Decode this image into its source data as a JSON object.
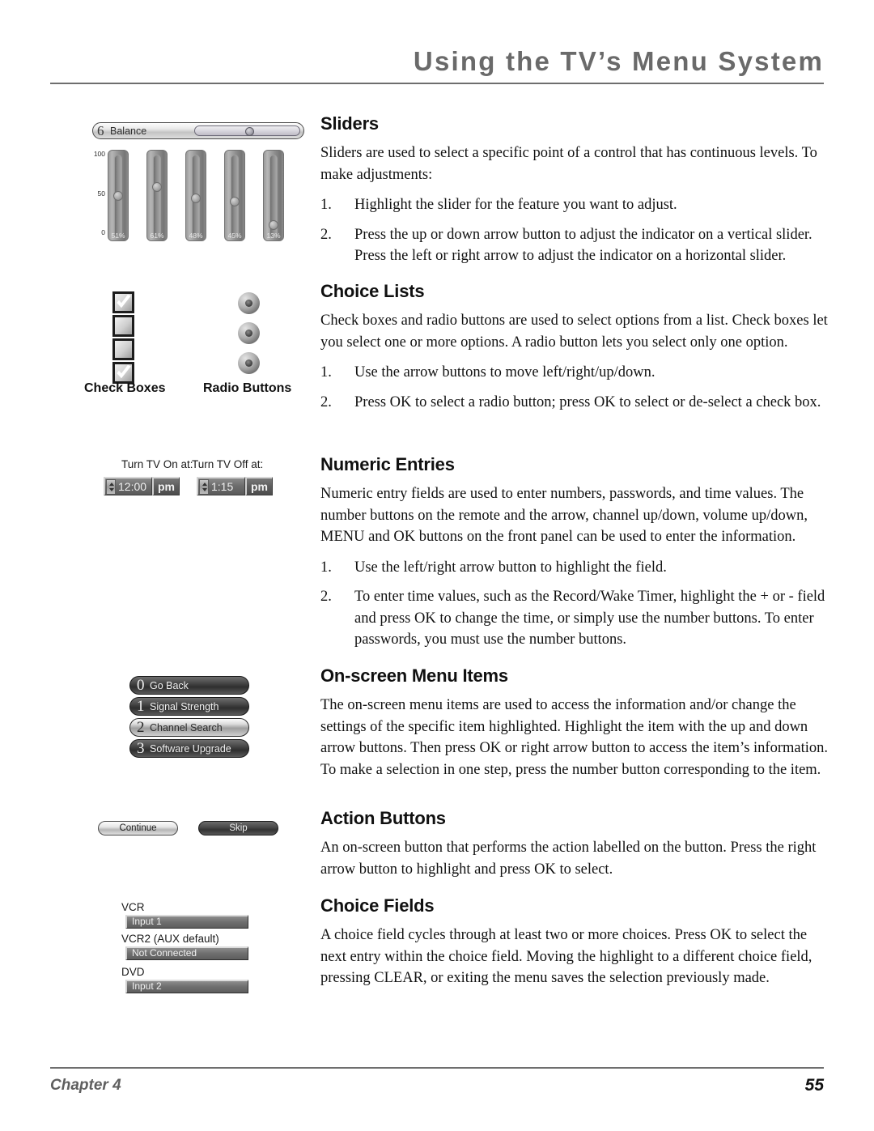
{
  "header": {
    "title": "Using the TV’s Menu System"
  },
  "footer": {
    "chapter": "Chapter 4",
    "page_number": "55"
  },
  "sections": {
    "sliders": {
      "heading": "Sliders",
      "intro": "Sliders are used to select a specific point of a control that has continuous levels. To make adjustments:",
      "steps": [
        {
          "num": "1.",
          "text": "Highlight the slider for the feature you want to adjust."
        },
        {
          "num": "2.",
          "text": "Press the up or down arrow button to adjust the indicator on a vertical slider. Press the left or right arrow to adjust the indicator on a horizontal slider."
        }
      ]
    },
    "choice_lists": {
      "heading": "Choice Lists",
      "intro": "Check boxes and radio buttons are used to select options from a list. Check boxes let you select one or more options. A radio button lets you select only one option.",
      "steps": [
        {
          "num": "1.",
          "text": "Use the arrow buttons to move left/right/up/down."
        },
        {
          "num": "2.",
          "text": "Press OK to select a radio button; press OK to select or de-select a check box."
        }
      ]
    },
    "numeric_entries": {
      "heading": "Numeric Entries",
      "intro": "Numeric entry fields are used to enter numbers, passwords, and time values. The number buttons on the remote and the arrow, channel up/down, volume up/down,  MENU and OK buttons on the front panel can be used to enter the information.",
      "steps": [
        {
          "num": "1.",
          "text": "Use the left/right arrow button to highlight the field."
        },
        {
          "num": "2.",
          "text": "To enter time values, such as the Record/Wake Timer, highlight the + or - field and press OK to change the time, or simply use the number buttons. To enter passwords, you must use the number buttons."
        }
      ]
    },
    "on_screen_menu_items": {
      "heading": "On-screen Menu Items",
      "intro": "The on-screen menu items are used to access the information and/or change the settings of the specific item highlighted. Highlight the item with the up and down arrow buttons. Then press OK or right arrow button to access the item’s information. To make a selection in one step, press the number button corresponding to the item."
    },
    "action_buttons": {
      "heading": "Action Buttons",
      "intro": "An on-screen button that performs the action labelled on the button. Press the right arrow button to highlight and press OK to select."
    },
    "choice_fields": {
      "heading": "Choice Fields",
      "intro": "A choice field cycles through at least two or more choices. Press OK to select the next entry within the choice field. Moving the highlight to a different choice field, pressing CLEAR, or exiting the menu saves the selection previously made."
    }
  },
  "figures": {
    "slider_figure": {
      "balance": {
        "number": "6",
        "label": "Balance"
      },
      "axis_ticks": [
        "100",
        "50",
        "0"
      ],
      "vertical_sliders": [
        {
          "percent": "51%",
          "value": 51
        },
        {
          "percent": "61%",
          "value": 61
        },
        {
          "percent": "48%",
          "value": 48
        },
        {
          "percent": "45%",
          "value": 45
        },
        {
          "percent": "13%",
          "value": 13
        }
      ]
    },
    "choice_list_figure": {
      "check_boxes_caption": "Check Boxes",
      "radio_buttons_caption": "Radio Buttons",
      "check_boxes": [
        {
          "checked": true
        },
        {
          "checked": false
        },
        {
          "checked": false
        },
        {
          "checked": true
        }
      ],
      "radio_buttons": [
        {
          "selected": false
        },
        {
          "selected": false
        },
        {
          "selected": false
        }
      ]
    },
    "numeric_figure": {
      "on_label": "Turn TV On at:",
      "on_time": "12:00",
      "on_ampm": "pm",
      "off_label": "Turn TV Off at:",
      "off_time": "1:15",
      "off_ampm": "pm"
    },
    "menu_items_figure": {
      "items": [
        {
          "number": "0",
          "label": "Go Back",
          "highlighted": true
        },
        {
          "number": "1",
          "label": "Signal Strength",
          "highlighted": true
        },
        {
          "number": "2",
          "label": "Channel Search",
          "highlighted": false
        },
        {
          "number": "3",
          "label": "Software Upgrade",
          "highlighted": true
        }
      ]
    },
    "action_buttons_figure": {
      "continue_label": "Continue",
      "skip_label": "Skip"
    },
    "choice_fields_figure": {
      "rows": [
        {
          "label": "VCR",
          "value": "Input 1"
        },
        {
          "label": "VCR2 (AUX default)",
          "value": "Not Connected"
        },
        {
          "label": "DVD",
          "value": "Input 2"
        }
      ]
    }
  }
}
